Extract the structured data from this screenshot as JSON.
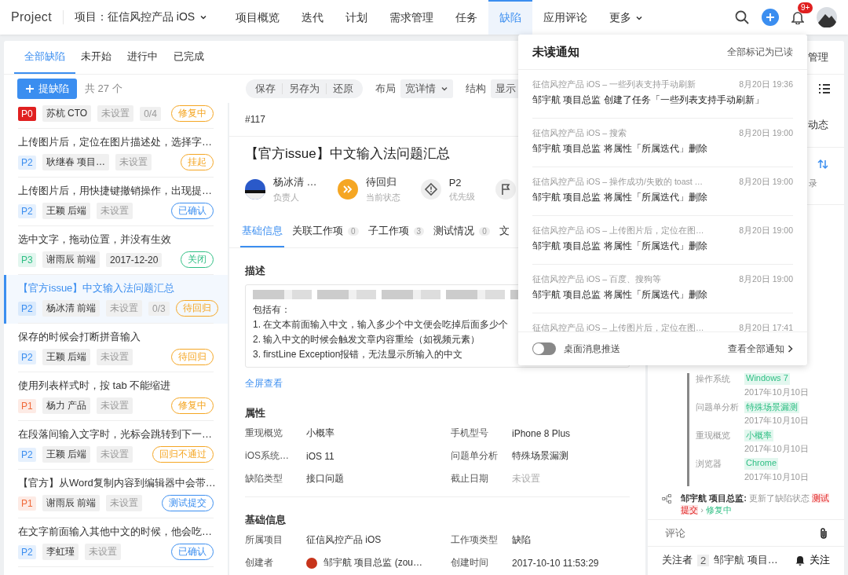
{
  "nav": {
    "logo": "Project",
    "project": "项目：征信风控产品 iOS",
    "items": [
      {
        "label": "项目概览",
        "selected": false
      },
      {
        "label": "迭代",
        "selected": false
      },
      {
        "label": "计划",
        "selected": false
      },
      {
        "label": "需求管理",
        "selected": false
      },
      {
        "label": "任务",
        "selected": false
      },
      {
        "label": "缺陷",
        "selected": true
      },
      {
        "label": "应用评论",
        "selected": false
      }
    ],
    "more": "更多",
    "badge": "9+"
  },
  "filters": {
    "tabs": [
      {
        "label": "全部缺陷",
        "selected": true
      },
      {
        "label": "未开始",
        "selected": false
      },
      {
        "label": "进行中",
        "selected": false
      },
      {
        "label": "已完成",
        "selected": false
      }
    ],
    "right": "管理"
  },
  "toolbar": {
    "add": "提缺陷",
    "count": "共 27 个",
    "actions": [
      "保存",
      "另存为",
      "还原"
    ],
    "layout_label": "布局",
    "layout_value": "宽详情",
    "structure_label": "结构",
    "structure_value": "显示"
  },
  "issues": [
    {
      "kind": "partial",
      "priority": {
        "label": "P0",
        "color": "#e02020"
      },
      "assignee": "苏杭 CTO",
      "date": "未设置",
      "progress": "0/4",
      "status": {
        "label": "修复中",
        "color": "#f5a623"
      },
      "selected": false
    },
    {
      "kind": "full",
      "title": "上传图片后，定位在图片描述处，选择字…",
      "priority": {
        "label": "P2",
        "color": "#3b8ef0"
      },
      "assignee": "耿继春 项目…",
      "date": "未设置",
      "status": {
        "label": "挂起",
        "color": "#f5a623"
      },
      "selected": false
    },
    {
      "kind": "full",
      "title": "上传图片后，用快捷键撤销操作，出现提…",
      "priority": {
        "label": "P2",
        "color": "#3b8ef0"
      },
      "assignee": "王颖 后端",
      "date": "未设置",
      "status": {
        "label": "已确认",
        "color": "#3b8ef0"
      },
      "selected": false
    },
    {
      "kind": "full",
      "title": "选中文字，拖动位置，并没有生效",
      "priority": {
        "label": "P3",
        "color": "#2fbf84"
      },
      "assignee": "谢雨辰 前端",
      "date": "2017-12-20",
      "status": {
        "label": "关闭",
        "color": "#2fbf84"
      },
      "selected": false
    },
    {
      "kind": "full",
      "title": "【官方issue】中文输入法问题汇总",
      "priority": {
        "label": "P2",
        "color": "#3b8ef0"
      },
      "assignee": "杨冰清 前端",
      "date": "未设置",
      "progress": "0/3",
      "status": {
        "label": "待回归",
        "color": "#f5a623"
      },
      "selected": true
    },
    {
      "kind": "full",
      "title": "保存的时候会打断拼音输入",
      "priority": {
        "label": "P2",
        "color": "#3b8ef0"
      },
      "assignee": "王颖 后端",
      "date": "未设置",
      "status": {
        "label": "待回归",
        "color": "#f5a623"
      },
      "selected": false
    },
    {
      "kind": "full",
      "title": "使用列表样式时，按 tab 不能缩进",
      "priority": {
        "label": "P1",
        "color": "#f06a3a"
      },
      "assignee": "杨力 产品",
      "date": "未设置",
      "status": {
        "label": "修复中",
        "color": "#f5a623"
      },
      "selected": false
    },
    {
      "kind": "full",
      "title": "在段落间输入文字时，光标会跳转到下一…",
      "priority": {
        "label": "P2",
        "color": "#3b8ef0"
      },
      "assignee": "王颖 后端",
      "date": "未设置",
      "status": {
        "label": "回归不通过",
        "color": "#f5a623"
      },
      "selected": false
    },
    {
      "kind": "full",
      "title": "【官方】从Word复制内容到编辑器中会带…",
      "priority": {
        "label": "P1",
        "color": "#f06a3a"
      },
      "assignee": "谢雨辰 前端",
      "date": "未设置",
      "status": {
        "label": "测试提交",
        "color": "#3b8ef0"
      },
      "selected": false
    },
    {
      "kind": "full",
      "title": "在文字前面输入其他中文的时候，他会吃…",
      "priority": {
        "label": "P2",
        "color": "#3b8ef0"
      },
      "assignee": "李虹瑾",
      "date": "未设置",
      "status": {
        "label": "已确认",
        "color": "#3b8ef0"
      },
      "selected": false
    }
  ],
  "detail": {
    "number": "#117",
    "title": "【官方issue】中文输入法问题汇总",
    "meta": [
      {
        "kind": "person",
        "value": "杨冰清 …",
        "caption": "负责人"
      },
      {
        "kind": "status",
        "value": "待回归",
        "caption": "当前状态"
      },
      {
        "kind": "priority",
        "value": "P2",
        "caption": "优先级"
      },
      {
        "kind": "flag"
      }
    ],
    "tabs": [
      {
        "label": "基础信息",
        "selected": true
      },
      {
        "label": "关联工作项",
        "count": "0",
        "selected": false
      },
      {
        "label": "子工作项",
        "count": "3",
        "selected": false
      },
      {
        "label": "测试情况",
        "count": "0",
        "selected": false
      },
      {
        "label": "文",
        "selected": false
      }
    ],
    "description_heading": "描述",
    "description": [
      "包括有：",
      "1. 在文本前面输入中文，输入多少个中文便会吃掉后面多少个",
      "2. 输入中文的时候会触发文章内容重绘（如视频元素）",
      "3. firstLine Exception报错，无法显示所输入的中文"
    ],
    "fullscreen": "全屏查看",
    "sections": [
      {
        "heading": "属性",
        "fields": [
          {
            "label": "重现概览",
            "value": "小概率"
          },
          {
            "label": "手机型号",
            "value": "iPhone 8 Plus"
          },
          {
            "label": "iOS系统…",
            "value": "iOS 11"
          },
          {
            "label": "问题单分析",
            "value": "特殊场景漏测"
          },
          {
            "label": "缺陷类型",
            "value": "接口问题"
          },
          {
            "label": "截止日期",
            "value": "未设置",
            "empty": true
          }
        ]
      },
      {
        "heading": "基础信息",
        "fields": [
          {
            "label": "所属项目",
            "value": "征信风控产品 iOS"
          },
          {
            "label": "工作项类型",
            "value": "缺陷"
          },
          {
            "label": "创建者",
            "value": "邹宇航 项目总监 (zou…",
            "avatar": true
          },
          {
            "label": "创建时间",
            "value": "2017-10-10 11:53:29"
          }
        ]
      }
    ]
  },
  "activity": {
    "tab": "动态",
    "record": "录",
    "changes": [
      {
        "label": "操作系统",
        "value": "Windows 7",
        "date": "2017年10月10日"
      },
      {
        "label": "问题单分析",
        "value": "特殊场景漏测",
        "date": "2017年10月10日"
      },
      {
        "label": "重现概览",
        "value": "小概率",
        "date": "2017年10月10日"
      },
      {
        "label": "浏览器",
        "value": "Chrome",
        "date": "2017年10月10日"
      }
    ],
    "event": {
      "user": "邹宇航 项目总监:",
      "action": "更新了缺陷状态",
      "from": "测试提交",
      "separator": "›",
      "to": "修复中"
    },
    "comment_placeholder": "评论",
    "followers_label": "关注者",
    "followers_count": "2",
    "followers": "邹宇航 项目…",
    "follow": "关注"
  },
  "notifications": {
    "title": "未读通知",
    "mark_all": "全部标记为已读",
    "items": [
      {
        "source": "征信风控产品 iOS – 一些列表支持手动刷新",
        "time": "8月20日 19:36",
        "text": "邹宇航 项目总监 创建了任务「一些列表支持手动刷新」"
      },
      {
        "source": "征信风控产品 iOS – 搜索",
        "time": "8月20日 19:00",
        "text": "邹宇航 项目总监 将属性「所属迭代」删除"
      },
      {
        "source": "征信风控产品 iOS – 操作成功/失败的 toast …",
        "time": "8月20日 19:00",
        "text": "邹宇航 项目总监 将属性「所属迭代」删除"
      },
      {
        "source": "征信风控产品 iOS – 上传图片后，定位在图…",
        "time": "8月20日 19:00",
        "text": "邹宇航 项目总监 将属性「所属迭代」删除"
      },
      {
        "source": "征信风控产品 iOS – 百度、搜狗等",
        "time": "8月20日 19:00",
        "text": "邹宇航 项目总监 将属性「所属迭代」删除"
      },
      {
        "source": "征信风控产品 iOS – 上传图片后，定位在图…",
        "time": "8月20日 17:41"
      }
    ],
    "desktop_push": {
      "label": "桌面消息推送",
      "on": false
    },
    "view_all": "查看全部通知"
  }
}
